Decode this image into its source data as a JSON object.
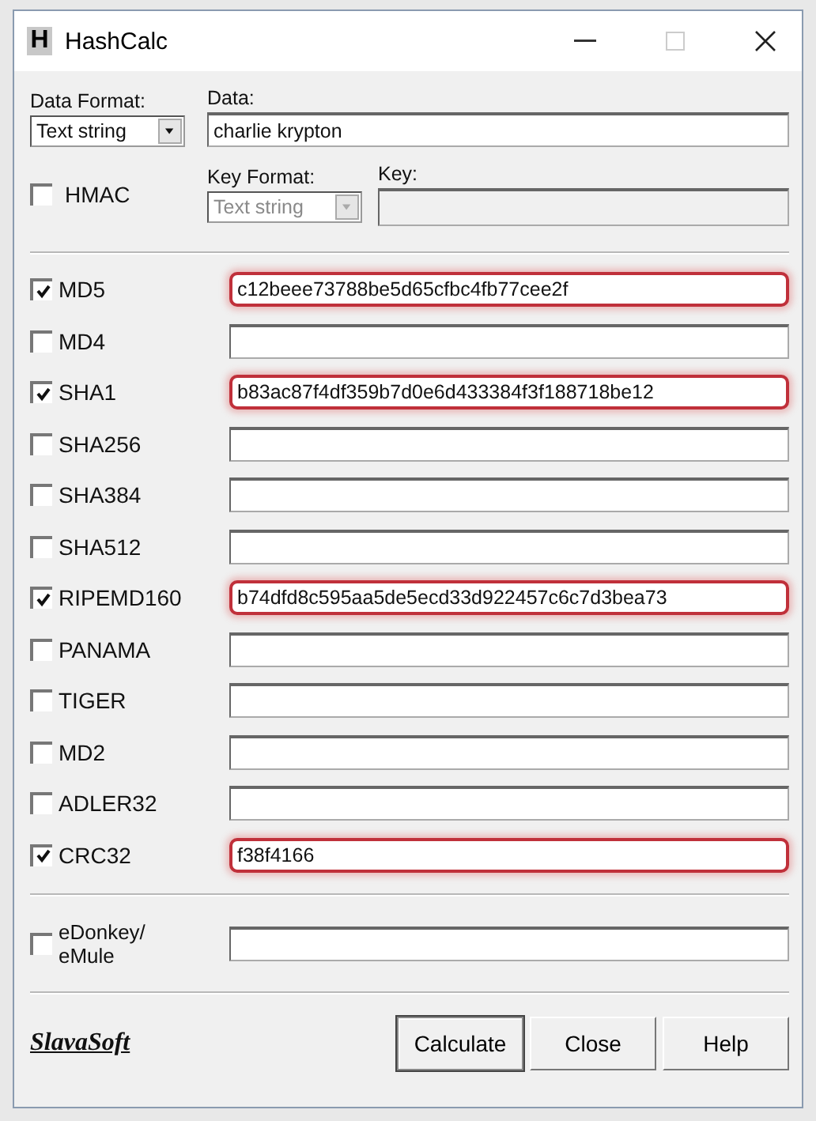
{
  "window": {
    "title": "HashCalc",
    "app_icon_letter": "H"
  },
  "data_format": {
    "label": "Data Format:",
    "value": "Text string"
  },
  "data": {
    "label": "Data:",
    "value": "charlie krypton"
  },
  "hmac": {
    "label": "HMAC",
    "checked": false
  },
  "key_format": {
    "label": "Key Format:",
    "value": "Text string",
    "disabled": true
  },
  "key": {
    "label": "Key:",
    "disabled": true
  },
  "hashes": [
    {
      "name": "MD5",
      "checked": true,
      "value": "c12beee73788be5d65cfbc4fb77cee2f",
      "highlighted": true
    },
    {
      "name": "MD4",
      "checked": false,
      "highlighted": false
    },
    {
      "name": "SHA1",
      "checked": true,
      "value": "b83ac87f4df359b7d0e6d433384f3f188718be12",
      "highlighted": true
    },
    {
      "name": "SHA256",
      "checked": false,
      "highlighted": false
    },
    {
      "name": "SHA384",
      "checked": false,
      "highlighted": false
    },
    {
      "name": "SHA512",
      "checked": false,
      "highlighted": false
    },
    {
      "name": "RIPEMD160",
      "checked": true,
      "value": "b74dfd8c595aa5de5ecd33d922457c6c7d3bea73",
      "highlighted": true
    },
    {
      "name": "PANAMA",
      "checked": false,
      "highlighted": false
    },
    {
      "name": "TIGER",
      "checked": false,
      "highlighted": false
    },
    {
      "name": "MD2",
      "checked": false,
      "highlighted": false
    },
    {
      "name": "ADLER32",
      "checked": false,
      "highlighted": false
    },
    {
      "name": "CRC32",
      "checked": true,
      "value": "f38f4166",
      "highlighted": true
    }
  ],
  "edonkey": {
    "label_lines": [
      "eDonkey/",
      "eMule"
    ],
    "checked": false
  },
  "brand": "SlavaSoft",
  "buttons": [
    {
      "label": "Calculate",
      "default": true
    },
    {
      "label": "Close",
      "default": false
    },
    {
      "label": "Help",
      "default": false
    }
  ]
}
